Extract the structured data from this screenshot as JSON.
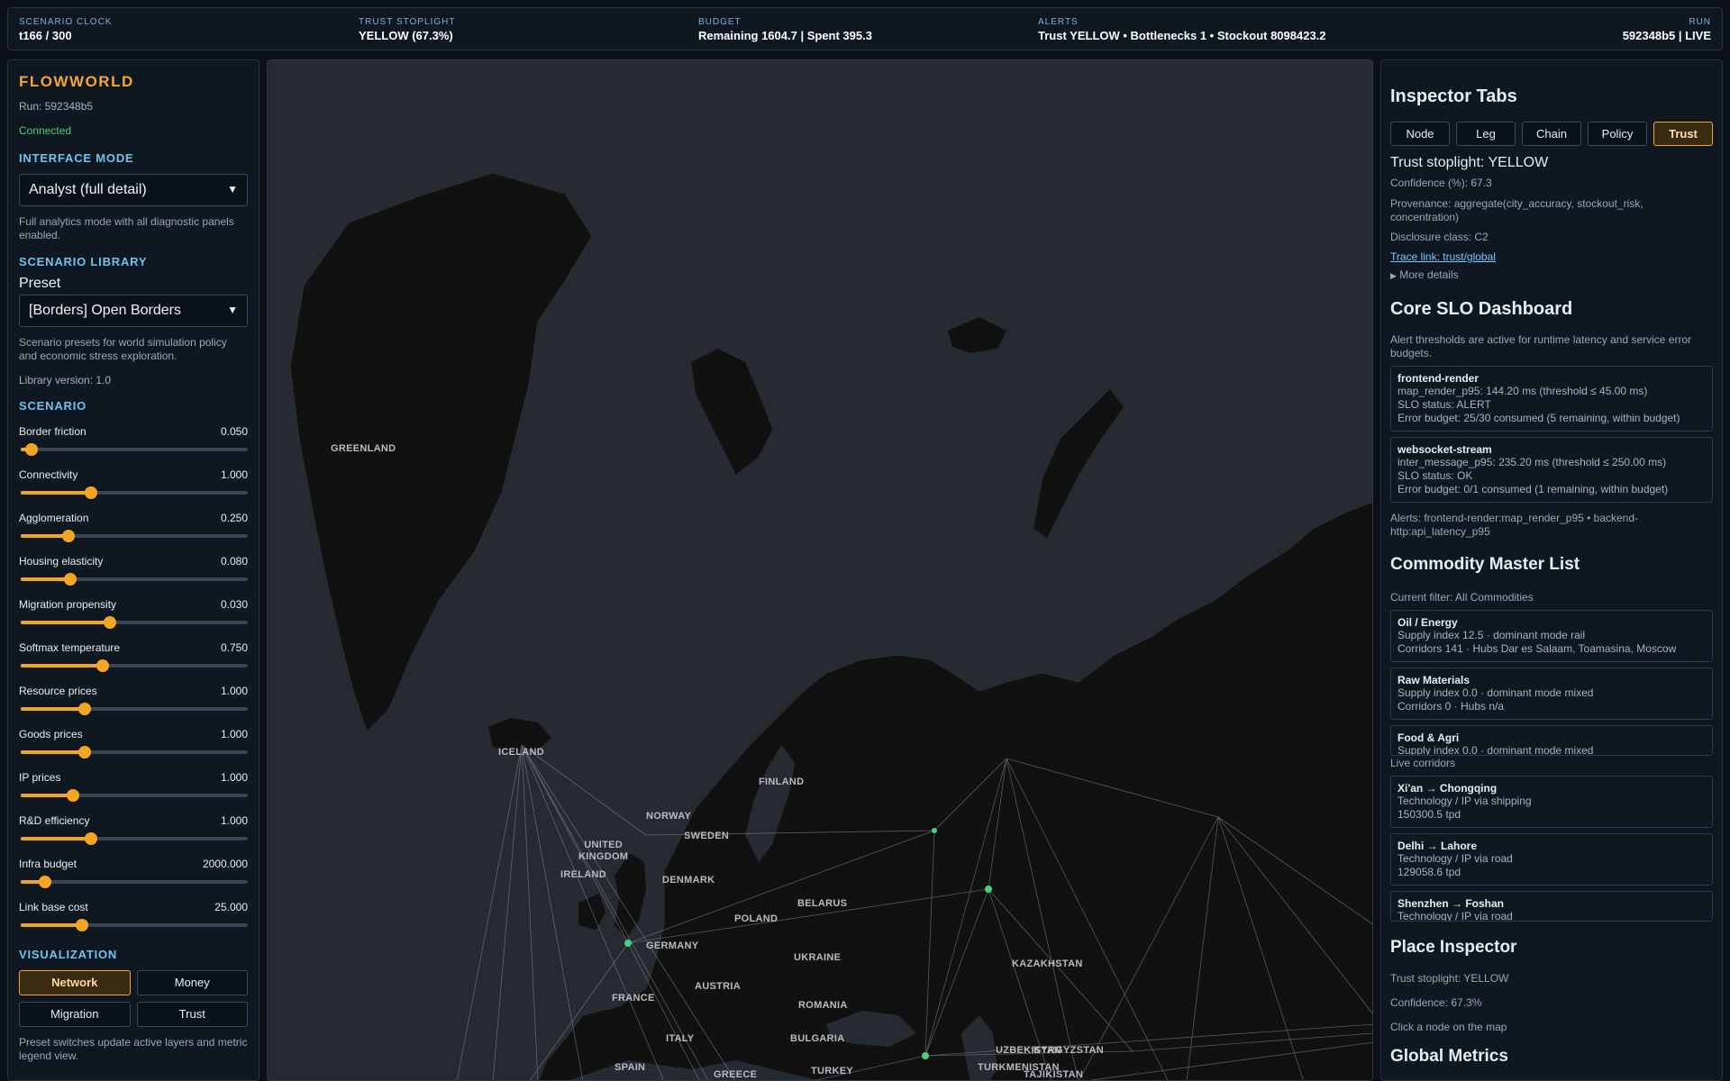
{
  "topbar": {
    "clock_label": "SCENARIO CLOCK",
    "clock_value": "t166 / 300",
    "trust_label": "TRUST STOPLIGHT",
    "trust_value": "YELLOW (67.3%)",
    "budget_label": "BUDGET",
    "budget_value": "Remaining 1604.7 | Spent 395.3",
    "alerts_label": "ALERTS",
    "alerts_value": "Trust YELLOW • Bottlenecks 1 • Stockout 8098423.2",
    "run_label": "RUN",
    "run_value": "592348b5 | LIVE"
  },
  "left": {
    "brand": "FLOWWORLD",
    "run": "Run: 592348b5",
    "status": "Connected",
    "interface_mode_heading": "INTERFACE MODE",
    "interface_mode_value": "Analyst (full detail)",
    "interface_mode_hint": "Full analytics mode with all diagnostic panels enabled.",
    "library_heading": "SCENARIO LIBRARY",
    "preset_label": "Preset",
    "preset_value": "[Borders] Open Borders",
    "library_hint": "Scenario presets for world simulation policy and economic stress exploration.",
    "library_version": "Library version: 1.0",
    "scenario_heading": "SCENARIO",
    "sliders": [
      {
        "label": "Border friction",
        "value": "0.050",
        "fraction": 0.04
      },
      {
        "label": "Connectivity",
        "value": "1.000",
        "fraction": 0.3
      },
      {
        "label": "Agglomeration",
        "value": "0.250",
        "fraction": 0.2
      },
      {
        "label": "Housing elasticity",
        "value": "0.080",
        "fraction": 0.21
      },
      {
        "label": "Migration propensity",
        "value": "0.030",
        "fraction": 0.38
      },
      {
        "label": "Softmax temperature",
        "value": "0.750",
        "fraction": 0.35
      },
      {
        "label": "Resource prices",
        "value": "1.000",
        "fraction": 0.27
      },
      {
        "label": "Goods prices",
        "value": "1.000",
        "fraction": 0.27
      },
      {
        "label": "IP prices",
        "value": "1.000",
        "fraction": 0.22
      },
      {
        "label": "R&D efficiency",
        "value": "1.000",
        "fraction": 0.3
      },
      {
        "label": "Infra budget",
        "value": "2000.000",
        "fraction": 0.1
      },
      {
        "label": "Link base cost",
        "value": "25.000",
        "fraction": 0.26
      }
    ],
    "viz_heading": "VISUALIZATION",
    "viz_buttons": [
      "Network",
      "Money",
      "Migration",
      "Trust"
    ],
    "viz_hint": "Preset switches update active layers and metric legend view."
  },
  "map": {
    "labels": [
      "GREENLAND",
      "ICELAND",
      "NORWAY",
      "SWEDEN",
      "FINLAND",
      "UNITED\nKINGDOM",
      "IRELAND",
      "DENMARK",
      "BELARUS",
      "POLAND",
      "GERMANY",
      "UKRAINE",
      "FRANCE",
      "AUSTRIA",
      "ROMANIA",
      "ITALY",
      "BULGARIA",
      "SPAIN",
      "GREECE",
      "TURKEY",
      "KAZAKHSTAN",
      "UZBEKISTAN",
      "KYRGYZSTAN",
      "TURKMENISTAN",
      "TAJIKISTAN"
    ]
  },
  "right": {
    "inspector_heading": "Inspector Tabs",
    "tabs": [
      "Node",
      "Leg",
      "Chain",
      "Policy",
      "Trust"
    ],
    "trust_title": "Trust stoplight: YELLOW",
    "confidence": "Confidence (%): 67.3",
    "provenance": "Provenance: aggregate(city_accuracy, stockout_risk, concentration)",
    "disclosure": "Disclosure class: C2",
    "trace_link": "Trace link: trust/global",
    "more_details": "More details",
    "slo_heading": "Core SLO Dashboard",
    "slo_hint": "Alert thresholds are active for runtime latency and service error budgets.",
    "slo_cards": [
      {
        "title": "frontend-render",
        "lines": [
          "map_render_p95: 144.20 ms (threshold ≤ 45.00 ms)",
          "SLO status: ALERT",
          "Error budget: 25/30 consumed (5 remaining, within budget)"
        ]
      },
      {
        "title": "websocket-stream",
        "lines": [
          "inter_message_p95: 235.20 ms (threshold ≤ 250.00 ms)",
          "SLO status: OK",
          "Error budget: 0/1 consumed (1 remaining, within budget)"
        ]
      }
    ],
    "slo_alerts": "Alerts: frontend-render:map_render_p95 • backend-http:api_latency_p95",
    "commodity_heading": "Commodity Master List",
    "commodity_filter": "Current filter: All Commodities",
    "commodities": [
      {
        "title": "Oil / Energy",
        "lines": [
          "Supply index 12.5 · dominant mode rail",
          "Corridors 141 · Hubs Dar es Salaam, Toamasina, Moscow"
        ]
      },
      {
        "title": "Raw Materials",
        "lines": [
          "Supply index 0.0 · dominant mode mixed",
          "Corridors 0 · Hubs n/a"
        ]
      },
      {
        "title": "Food & Agri",
        "lines": [
          "Supply index 0.0 · dominant mode mixed"
        ]
      }
    ],
    "live_corridors_label": "Live corridors",
    "corridors": [
      {
        "title": "Xi'an → Chongqing",
        "lines": [
          "Technology / IP via shipping",
          "150300.5 tpd"
        ]
      },
      {
        "title": "Delhi → Lahore",
        "lines": [
          "Technology / IP via road",
          "129058.6 tpd"
        ]
      },
      {
        "title": "Shenzhen → Foshan",
        "lines": [
          "Technology / IP via road"
        ]
      }
    ],
    "place_heading": "Place Inspector",
    "place_trust": "Trust stoplight: YELLOW",
    "place_confidence": "Confidence: 67.3%",
    "place_hint": "Click a node on the map",
    "global_heading": "Global Metrics"
  },
  "colors": {
    "accent": "#f5a524",
    "link": "#7cc7ff",
    "ok": "#4ad07a",
    "heading": "#6ec3f2",
    "land": "#111111",
    "sea": "#262b31"
  }
}
